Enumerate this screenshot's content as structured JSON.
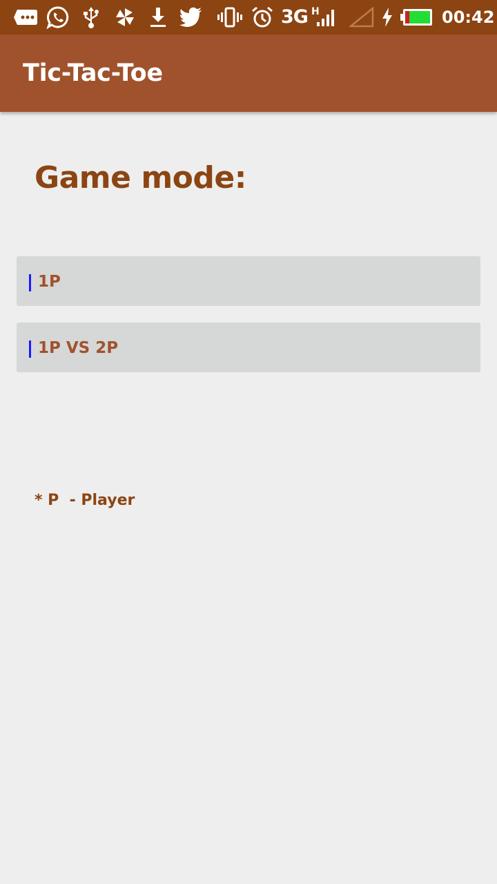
{
  "status_bar": {
    "network": "3G",
    "network_sub": "H",
    "time": "00:42",
    "battery_color": "#22dd33",
    "icons": [
      "message-icon",
      "whatsapp-icon",
      "usb-icon",
      "pinwheel-icon",
      "download-icon",
      "twitter-icon",
      "vibrate-icon",
      "alarm-icon",
      "signal-icon",
      "no-signal-icon",
      "charging-icon",
      "battery-icon"
    ]
  },
  "app_bar": {
    "title": "Tic-Tac-Toe",
    "color": "#a0522d"
  },
  "main": {
    "heading": "Game mode:",
    "buttons": [
      {
        "label": "1P"
      },
      {
        "label": "1P VS 2P"
      }
    ],
    "footnote": "* P  - Player"
  },
  "colors": {
    "status_bar": "#8c4412",
    "accent_text": "#8b4513",
    "button_bg": "#d6d7d7",
    "background": "#eeeeee"
  }
}
